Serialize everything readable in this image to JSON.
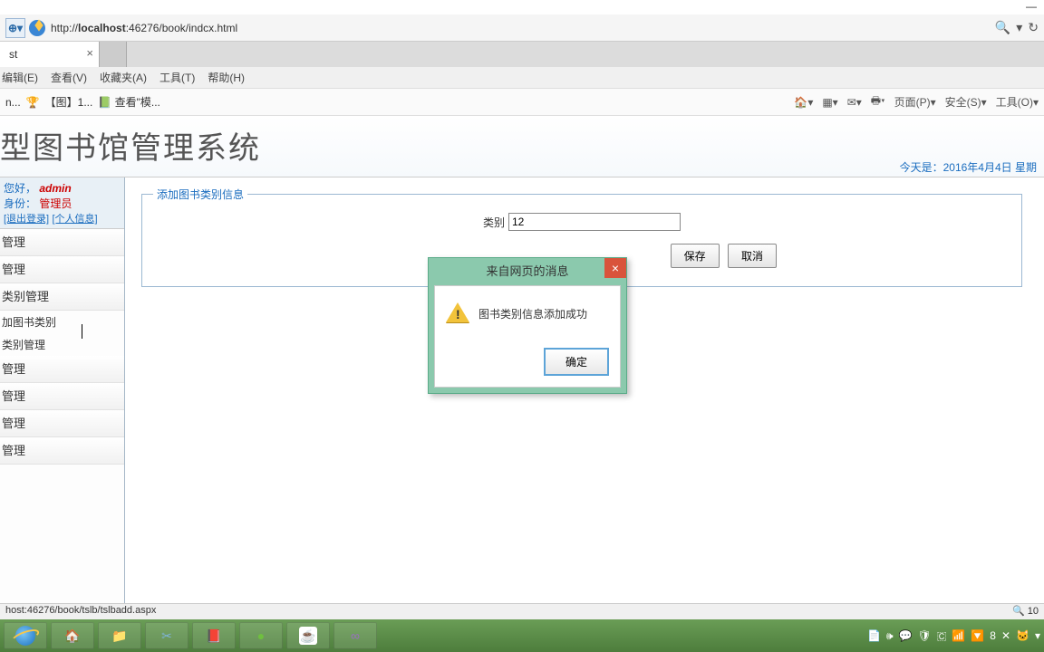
{
  "window": {
    "minimize": "—"
  },
  "addressbar": {
    "url_prefix": "http://",
    "url_host": "localhost",
    "url_rest": ":46276/book/indcx.html",
    "search_icon": "🔍",
    "refresh_icon": "↻"
  },
  "tab": {
    "title": "st",
    "close": "×"
  },
  "menubar": {
    "items": [
      "编辑(E)",
      "查看(V)",
      "收藏夹(A)",
      "工具(T)",
      "帮助(H)"
    ]
  },
  "toolbar": {
    "left_items": [
      "n...",
      "🏆",
      "【图】1...",
      "📗 查看\"模..."
    ],
    "right_items": [
      "🏠▾",
      "▦▾",
      "✉▾",
      "🖶▾",
      "页面(P)▾",
      "安全(S)▾",
      "工具(O)▾"
    ]
  },
  "system": {
    "title": "型图书馆管理系统",
    "date_label": "今天是：",
    "date_value": "2016年4月4日 星期"
  },
  "sidebar": {
    "greeting_label": "您好，",
    "greeting_user": "admin",
    "identity_label": "身份：",
    "identity_value": "管理员",
    "logout": "[退出登录]",
    "profile": "[个人信息]",
    "items": [
      "管理",
      "管理",
      "类别管理",
      "管理",
      "管理",
      "管理",
      "管理"
    ],
    "sub": {
      "add": "加图书类别",
      "manage": "类别管理"
    }
  },
  "form": {
    "legend": "添加图书类别信息",
    "label_category": "类别",
    "value_category": "12",
    "btn_save": "保存",
    "btn_cancel": "取消"
  },
  "dialog": {
    "title": "来自网页的消息",
    "message": "图书类别信息添加成功",
    "btn_ok": "确定",
    "close": "×",
    "exc": "!"
  },
  "statusbar": {
    "left": "host:46276/book/tslb/tslbadd.aspx",
    "right": "🔍 10"
  },
  "tray": {
    "icons": [
      "📄",
      "🕪",
      "💬",
      "🛡",
      "🇨",
      "📶",
      "🔽",
      "8",
      "✕",
      "🐱",
      "▾"
    ]
  }
}
